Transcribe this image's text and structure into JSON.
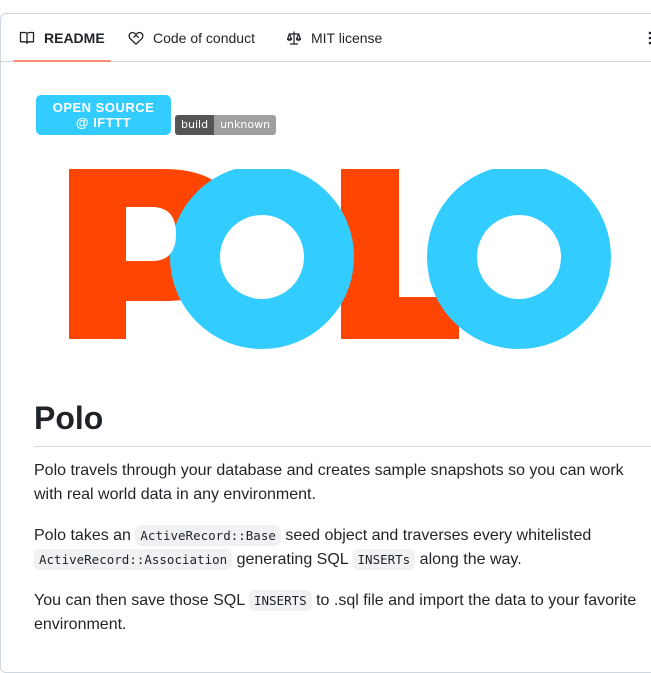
{
  "tabs": [
    {
      "label": "README",
      "icon": "book-icon"
    },
    {
      "label": "Code of conduct",
      "icon": "heart-handshake-icon"
    },
    {
      "label": "MIT license",
      "icon": "law-icon"
    }
  ],
  "badges": {
    "open_source_line1": "OPEN SOURCE",
    "open_source_line2": "@ IFTTT",
    "build_label": "build",
    "build_status": "unknown"
  },
  "logo": {
    "text": "POLO",
    "colors": {
      "orange": "#ff4500",
      "blue": "#33ccff"
    }
  },
  "readme": {
    "heading": "Polo",
    "p1": "Polo travels through your database and creates sample snapshots so you can work with real world data in any environment.",
    "p2": {
      "a": "Polo takes an ",
      "code1": "ActiveRecord::Base",
      "b": " seed object and traverses every whitelisted ",
      "code2": "ActiveRecord::Association",
      "c": " generating SQL ",
      "code3": "INSERTs",
      "d": " along the way."
    },
    "p3": {
      "a": "You can then save those SQL ",
      "code1": "INSERTS",
      "b": " to .sql file and import the data to your favorite environment."
    }
  },
  "colors": {
    "accent_underline": "#fd8c73",
    "text": "#1f2328",
    "border": "#d0d7de"
  }
}
